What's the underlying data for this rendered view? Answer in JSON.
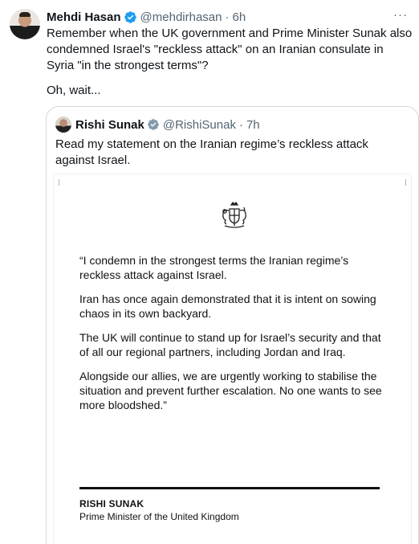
{
  "tweet": {
    "author_name": "Mehdi Hasan",
    "handle": "@mehdirhasan",
    "separator": "·",
    "time": "6h",
    "text_1": "Remember when the UK government and Prime Minister Sunak also condemned Israel's \"reckless attack\" on an Iranian consulate in Syria \"in the strongest terms\"?",
    "text_2": "Oh, wait...",
    "more_label": "···"
  },
  "quoted": {
    "author_name": "Rishi Sunak",
    "handle": "@RishiSunak",
    "separator": "·",
    "time": "7h",
    "text": "Read my statement on the Iranian regime’s reckless attack against Israel."
  },
  "statement": {
    "paragraphs": [
      "“I condemn in the strongest terms the Iranian regime’s reckless attack against Israel.",
      "Iran has once again demonstrated that it is intent on sowing chaos in its own backyard.",
      "The UK will continue to stand up for Israel’s security and that of all our regional partners, including Jordan and Iraq.",
      "Alongside our allies, we are urgently working to stabilise the situation and prevent further escalation. No one wants to see more bloodshed.”"
    ],
    "signature_name": "RISHI SUNAK",
    "signature_title": "Prime Minister of the United Kingdom"
  },
  "colors": {
    "verified": "#1d9bf0",
    "muted_text": "#536471",
    "border": "#cfd9de"
  },
  "icons": {
    "verified": "verified-badge-icon",
    "more": "more-options-icon",
    "crest": "royal-coat-of-arms-icon"
  }
}
